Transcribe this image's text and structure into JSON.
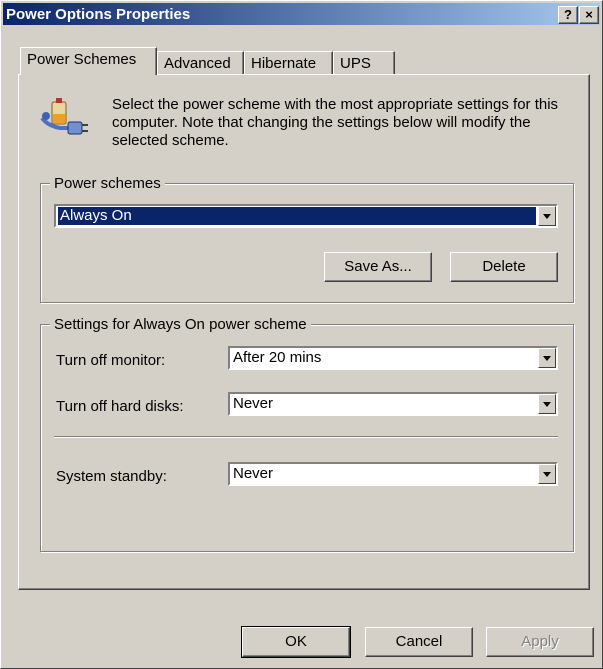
{
  "window": {
    "title": "Power Options Properties",
    "help_label": "?",
    "close_label": "×"
  },
  "tabs": [
    {
      "label": "Power Schemes",
      "active": true
    },
    {
      "label": "Advanced",
      "active": false
    },
    {
      "label": "Hibernate",
      "active": false
    },
    {
      "label": "UPS",
      "active": false
    }
  ],
  "description": "Select the power scheme with the most appropriate settings for this computer. Note that changing the settings below will modify the selected scheme.",
  "icon": "power-plug-battery-icon",
  "schemes_group": {
    "label": "Power schemes",
    "selected": "Always On",
    "save_as_label": "Save As...",
    "delete_label": "Delete"
  },
  "settings_group": {
    "label": "Settings for Always On power scheme",
    "monitor_label": "Turn off monitor:",
    "monitor_value": "After 20 mins",
    "disks_label": "Turn off hard disks:",
    "disks_value": "Never",
    "standby_label": "System standby:",
    "standby_value": "Never"
  },
  "footer": {
    "ok_label": "OK",
    "cancel_label": "Cancel",
    "apply_label": "Apply"
  },
  "colors": {
    "titlebar": "#0a246a",
    "face": "#d4d0c8",
    "selection": "#0a246a"
  }
}
